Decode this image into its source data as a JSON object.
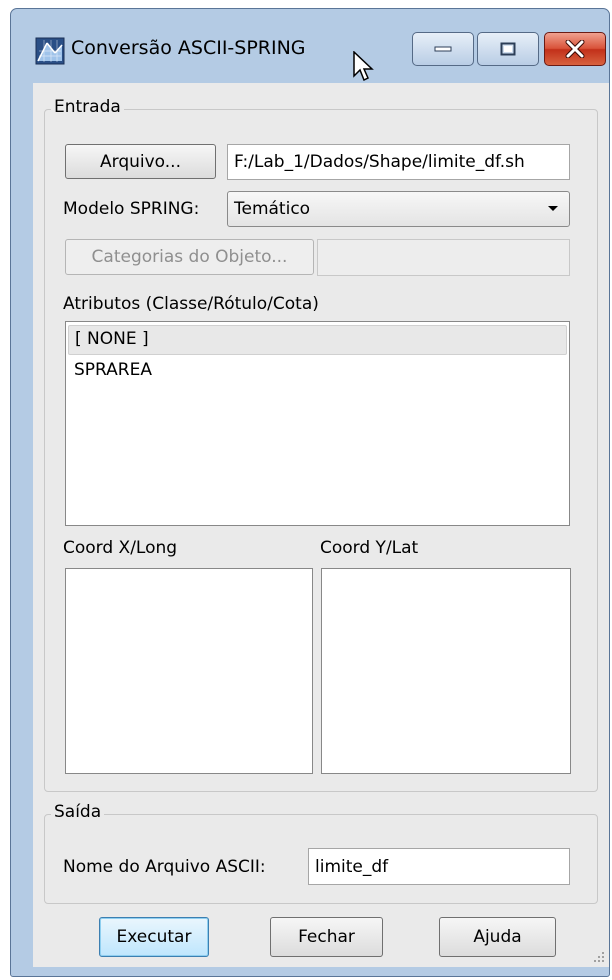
{
  "window": {
    "title": "Conversão ASCII-SPRING"
  },
  "entrada": {
    "group_title": "Entrada",
    "arquivo_button": "Arquivo...",
    "arquivo_path": "F:/Lab_1/Dados/Shape/limite_df.sh",
    "modelo_label": "Modelo SPRING:",
    "modelo_value": "Temático",
    "categorias_button": "Categorias do Objeto...",
    "categorias_value": "",
    "atributos_label": "Atributos (Classe/Rótulo/Cota)",
    "atributos_items": [
      "[ NONE ]",
      "SPRAREA"
    ],
    "coord_x_label": "Coord X/Long",
    "coord_y_label": "Coord Y/Lat"
  },
  "saida": {
    "group_title": "Saída",
    "nome_label": "Nome do Arquivo ASCII:",
    "nome_value": "limite_df"
  },
  "actions": {
    "executar": "Executar",
    "fechar": "Fechar",
    "ajuda": "Ajuda"
  }
}
